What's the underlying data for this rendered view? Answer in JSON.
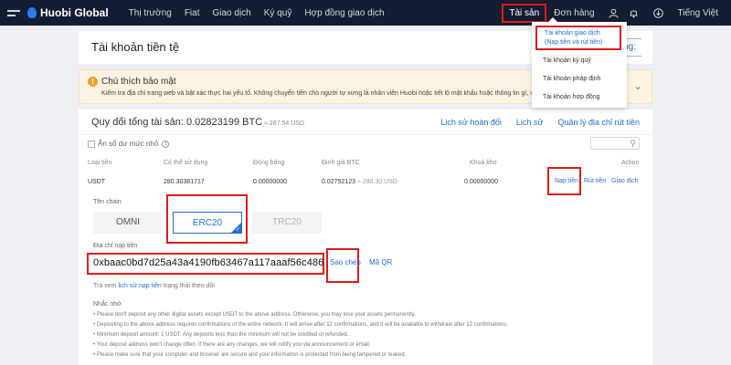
{
  "nav": {
    "logo": "Huobi Global",
    "items": [
      "Thị trường",
      "Fiat",
      "Giao dịch",
      "Ký quỹ",
      "Hợp đồng giao dịch"
    ],
    "assets": "Tài sản",
    "orders": "Đơn hàng",
    "language": "Tiếng Việt"
  },
  "dropdown": {
    "items": [
      "Tài khoản giao dịch",
      "(Nạp tiền và rút tiền)",
      "Tài khoản ký quỹ",
      "Tài khoản pháp định",
      "Tài khoản hợp đồng"
    ]
  },
  "page": {
    "title": "Tài khoản tiền tệ",
    "title_button_fragment": "ng:"
  },
  "notice": {
    "heading": "Chú thích bảo mật",
    "text": "Kiểm tra địa chỉ trang web và bật xác thực hai yếu tố. Không chuyển tiền cho người tự xưng là nhân viên Huobi hoặc tiết lộ mật khẩu hoặc thông tin gì, v.v."
  },
  "summary": {
    "label": "Quy đổi tổng tài sản: 0.02823199 BTC",
    "usd": "≈ 287.54 USD",
    "links": [
      "Lịch sử hoàn đổi",
      "Lịch sử",
      "Quản lý địa chỉ rút tiền"
    ]
  },
  "filter": {
    "hide_small": "Ẩn số dư mức nhỏ"
  },
  "table": {
    "headers": [
      "Loại tiền",
      "Có thể sử dụng",
      "Đóng băng",
      "Định giá BTC",
      "Khoá kho",
      "Action"
    ],
    "row": {
      "coin": "USDT",
      "available": "280.30381717",
      "frozen": "0.00000000",
      "btc_value": "0.02752123",
      "usd_value": "≈ 280.30 USD",
      "locked": "0.00000000",
      "actions": [
        "Nạp tiền",
        "Rút tiền",
        "Giao dịch"
      ]
    }
  },
  "deposit": {
    "chain_label": "Tên chain",
    "chains": [
      "OMNI",
      "ERC20",
      "TRC20"
    ],
    "selected_chain": "ERC20",
    "address_label": "Địa chỉ nạp tiền",
    "address": "0xbaac0bd7d25a43a4190fb63467a117aaaf56c486",
    "copy": "Sao chép",
    "qr": "Mã QR",
    "history_prefix": "Tra xem",
    "history_link": "lịch sử nạp tiền",
    "history_suffix": "trạng thái theo dõi",
    "notes_heading": "Nhắc nhở",
    "notes": [
      "• Please don't deposit any other digital assets except USDT to the above address. Otherwise, you may lose your assets permanently.",
      "• Depositing to the above address requires confirmations of the entire network. It will arrive after 12 confirmations, and it will be available to withdraw after 12 confirmations.",
      "• Minimum deposit amount: 1 USDT. Any deposits less than the minimum will not be credited or refunded.",
      "• Your deposit address won't change often. If there are any changes, we will notify you via announcement or email.",
      "• Please make sure that your computer and browser are secure and your information is protected from being tampered or leaked."
    ]
  }
}
